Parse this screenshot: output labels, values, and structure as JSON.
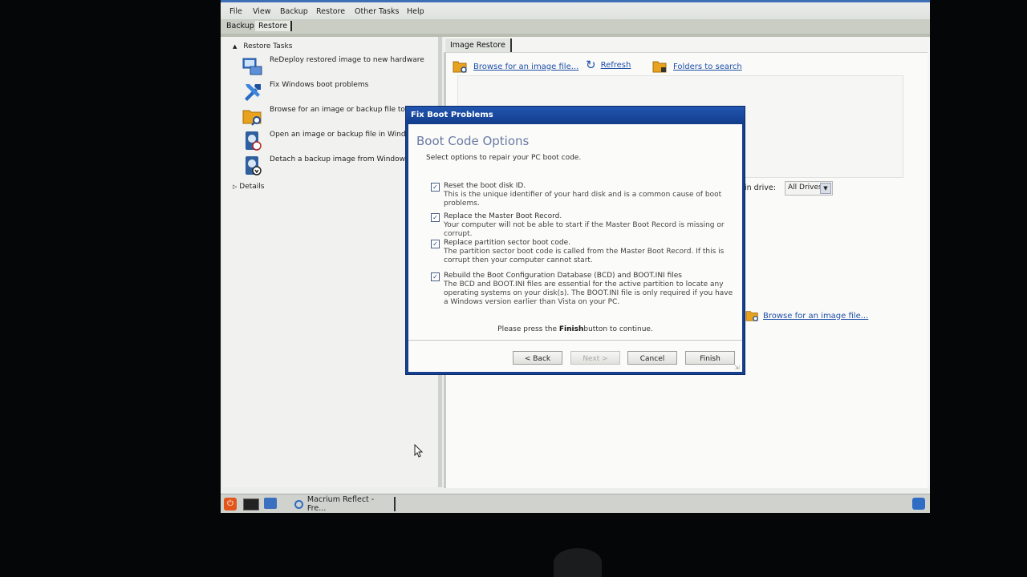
{
  "menu": [
    "File",
    "View",
    "Backup",
    "Restore",
    "Other Tasks",
    "Help"
  ],
  "tabs": {
    "backup": "Backup",
    "restore": "Restore"
  },
  "left": {
    "header": "Restore Tasks",
    "tasks": [
      "ReDeploy restored image to new hardware",
      "Fix Windows boot problems",
      "Browse for an image or backup file to rest",
      "Open an image or backup file in Windows",
      "Detach a backup image from Windows Ex"
    ],
    "details": "Details"
  },
  "right": {
    "tab": "Image Restore",
    "browse": "Browse for an image file...",
    "refresh": "Refresh",
    "folders": "Folders to search",
    "drive_label": "in drive:",
    "drive_value": "All Drives",
    "browse2": "Browse for an image file..."
  },
  "dialog": {
    "title": "Fix Boot Problems",
    "heading": "Boot Code Options",
    "subtitle": "Select options to repair your PC boot code.",
    "options": [
      {
        "title": "Reset the boot disk ID.",
        "desc": "This is the unique identifier of your hard disk and is a common cause of boot problems.",
        "checked": true
      },
      {
        "title": "Replace the Master Boot Record.",
        "desc": "Your computer will not be able to start if the Master Boot Record is missing or corrupt.",
        "checked": true
      },
      {
        "title": "Replace partition sector boot code.",
        "desc": "The partition sector boot code is called from the Master Boot Record. If this is corrupt then your computer cannot start.",
        "checked": true
      },
      {
        "title": "Rebuild the Boot Configuration Database (BCD) and BOOT.INI files",
        "desc": "The BCD and BOOT.INI files are essential for the active partition to locate any operating systems on your disk(s). The BOOT.INI file is only required if you have a Windows version earlier than Vista on your PC.",
        "checked": true
      }
    ],
    "hint_pre": "Please press the ",
    "hint_bold": "Finish",
    "hint_post": "button to continue.",
    "buttons": {
      "back": "< Back",
      "next": "Next >",
      "cancel": "Cancel",
      "finish": "Finish"
    }
  },
  "taskbar": {
    "app": "Macrium Reflect - Fre..."
  },
  "colors": {
    "accent": "#1f4fa8",
    "dialog_frame": "#153f8f"
  }
}
